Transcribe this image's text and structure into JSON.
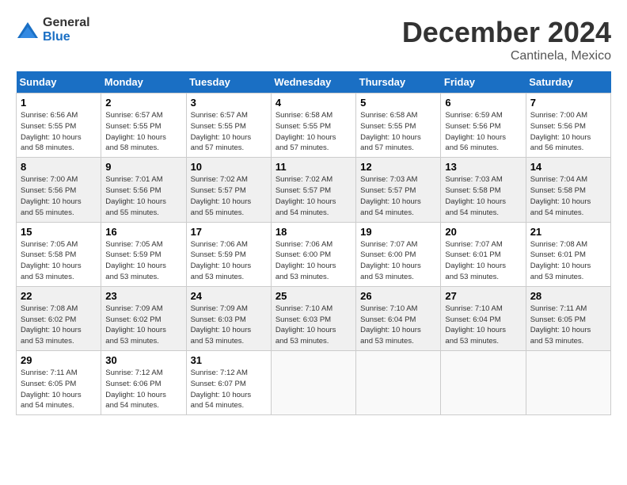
{
  "header": {
    "logo_general": "General",
    "logo_blue": "Blue",
    "month": "December 2024",
    "location": "Cantinela, Mexico"
  },
  "weekdays": [
    "Sunday",
    "Monday",
    "Tuesday",
    "Wednesday",
    "Thursday",
    "Friday",
    "Saturday"
  ],
  "weeks": [
    [
      {
        "day": "1",
        "info": "Sunrise: 6:56 AM\nSunset: 5:55 PM\nDaylight: 10 hours\nand 58 minutes."
      },
      {
        "day": "2",
        "info": "Sunrise: 6:57 AM\nSunset: 5:55 PM\nDaylight: 10 hours\nand 58 minutes."
      },
      {
        "day": "3",
        "info": "Sunrise: 6:57 AM\nSunset: 5:55 PM\nDaylight: 10 hours\nand 57 minutes."
      },
      {
        "day": "4",
        "info": "Sunrise: 6:58 AM\nSunset: 5:55 PM\nDaylight: 10 hours\nand 57 minutes."
      },
      {
        "day": "5",
        "info": "Sunrise: 6:58 AM\nSunset: 5:55 PM\nDaylight: 10 hours\nand 57 minutes."
      },
      {
        "day": "6",
        "info": "Sunrise: 6:59 AM\nSunset: 5:56 PM\nDaylight: 10 hours\nand 56 minutes."
      },
      {
        "day": "7",
        "info": "Sunrise: 7:00 AM\nSunset: 5:56 PM\nDaylight: 10 hours\nand 56 minutes."
      }
    ],
    [
      {
        "day": "8",
        "info": "Sunrise: 7:00 AM\nSunset: 5:56 PM\nDaylight: 10 hours\nand 55 minutes."
      },
      {
        "day": "9",
        "info": "Sunrise: 7:01 AM\nSunset: 5:56 PM\nDaylight: 10 hours\nand 55 minutes."
      },
      {
        "day": "10",
        "info": "Sunrise: 7:02 AM\nSunset: 5:57 PM\nDaylight: 10 hours\nand 55 minutes."
      },
      {
        "day": "11",
        "info": "Sunrise: 7:02 AM\nSunset: 5:57 PM\nDaylight: 10 hours\nand 54 minutes."
      },
      {
        "day": "12",
        "info": "Sunrise: 7:03 AM\nSunset: 5:57 PM\nDaylight: 10 hours\nand 54 minutes."
      },
      {
        "day": "13",
        "info": "Sunrise: 7:03 AM\nSunset: 5:58 PM\nDaylight: 10 hours\nand 54 minutes."
      },
      {
        "day": "14",
        "info": "Sunrise: 7:04 AM\nSunset: 5:58 PM\nDaylight: 10 hours\nand 54 minutes."
      }
    ],
    [
      {
        "day": "15",
        "info": "Sunrise: 7:05 AM\nSunset: 5:58 PM\nDaylight: 10 hours\nand 53 minutes."
      },
      {
        "day": "16",
        "info": "Sunrise: 7:05 AM\nSunset: 5:59 PM\nDaylight: 10 hours\nand 53 minutes."
      },
      {
        "day": "17",
        "info": "Sunrise: 7:06 AM\nSunset: 5:59 PM\nDaylight: 10 hours\nand 53 minutes."
      },
      {
        "day": "18",
        "info": "Sunrise: 7:06 AM\nSunset: 6:00 PM\nDaylight: 10 hours\nand 53 minutes."
      },
      {
        "day": "19",
        "info": "Sunrise: 7:07 AM\nSunset: 6:00 PM\nDaylight: 10 hours\nand 53 minutes."
      },
      {
        "day": "20",
        "info": "Sunrise: 7:07 AM\nSunset: 6:01 PM\nDaylight: 10 hours\nand 53 minutes."
      },
      {
        "day": "21",
        "info": "Sunrise: 7:08 AM\nSunset: 6:01 PM\nDaylight: 10 hours\nand 53 minutes."
      }
    ],
    [
      {
        "day": "22",
        "info": "Sunrise: 7:08 AM\nSunset: 6:02 PM\nDaylight: 10 hours\nand 53 minutes."
      },
      {
        "day": "23",
        "info": "Sunrise: 7:09 AM\nSunset: 6:02 PM\nDaylight: 10 hours\nand 53 minutes."
      },
      {
        "day": "24",
        "info": "Sunrise: 7:09 AM\nSunset: 6:03 PM\nDaylight: 10 hours\nand 53 minutes."
      },
      {
        "day": "25",
        "info": "Sunrise: 7:10 AM\nSunset: 6:03 PM\nDaylight: 10 hours\nand 53 minutes."
      },
      {
        "day": "26",
        "info": "Sunrise: 7:10 AM\nSunset: 6:04 PM\nDaylight: 10 hours\nand 53 minutes."
      },
      {
        "day": "27",
        "info": "Sunrise: 7:10 AM\nSunset: 6:04 PM\nDaylight: 10 hours\nand 53 minutes."
      },
      {
        "day": "28",
        "info": "Sunrise: 7:11 AM\nSunset: 6:05 PM\nDaylight: 10 hours\nand 53 minutes."
      }
    ],
    [
      {
        "day": "29",
        "info": "Sunrise: 7:11 AM\nSunset: 6:05 PM\nDaylight: 10 hours\nand 54 minutes."
      },
      {
        "day": "30",
        "info": "Sunrise: 7:12 AM\nSunset: 6:06 PM\nDaylight: 10 hours\nand 54 minutes."
      },
      {
        "day": "31",
        "info": "Sunrise: 7:12 AM\nSunset: 6:07 PM\nDaylight: 10 hours\nand 54 minutes."
      },
      {
        "day": "",
        "info": ""
      },
      {
        "day": "",
        "info": ""
      },
      {
        "day": "",
        "info": ""
      },
      {
        "day": "",
        "info": ""
      }
    ]
  ]
}
